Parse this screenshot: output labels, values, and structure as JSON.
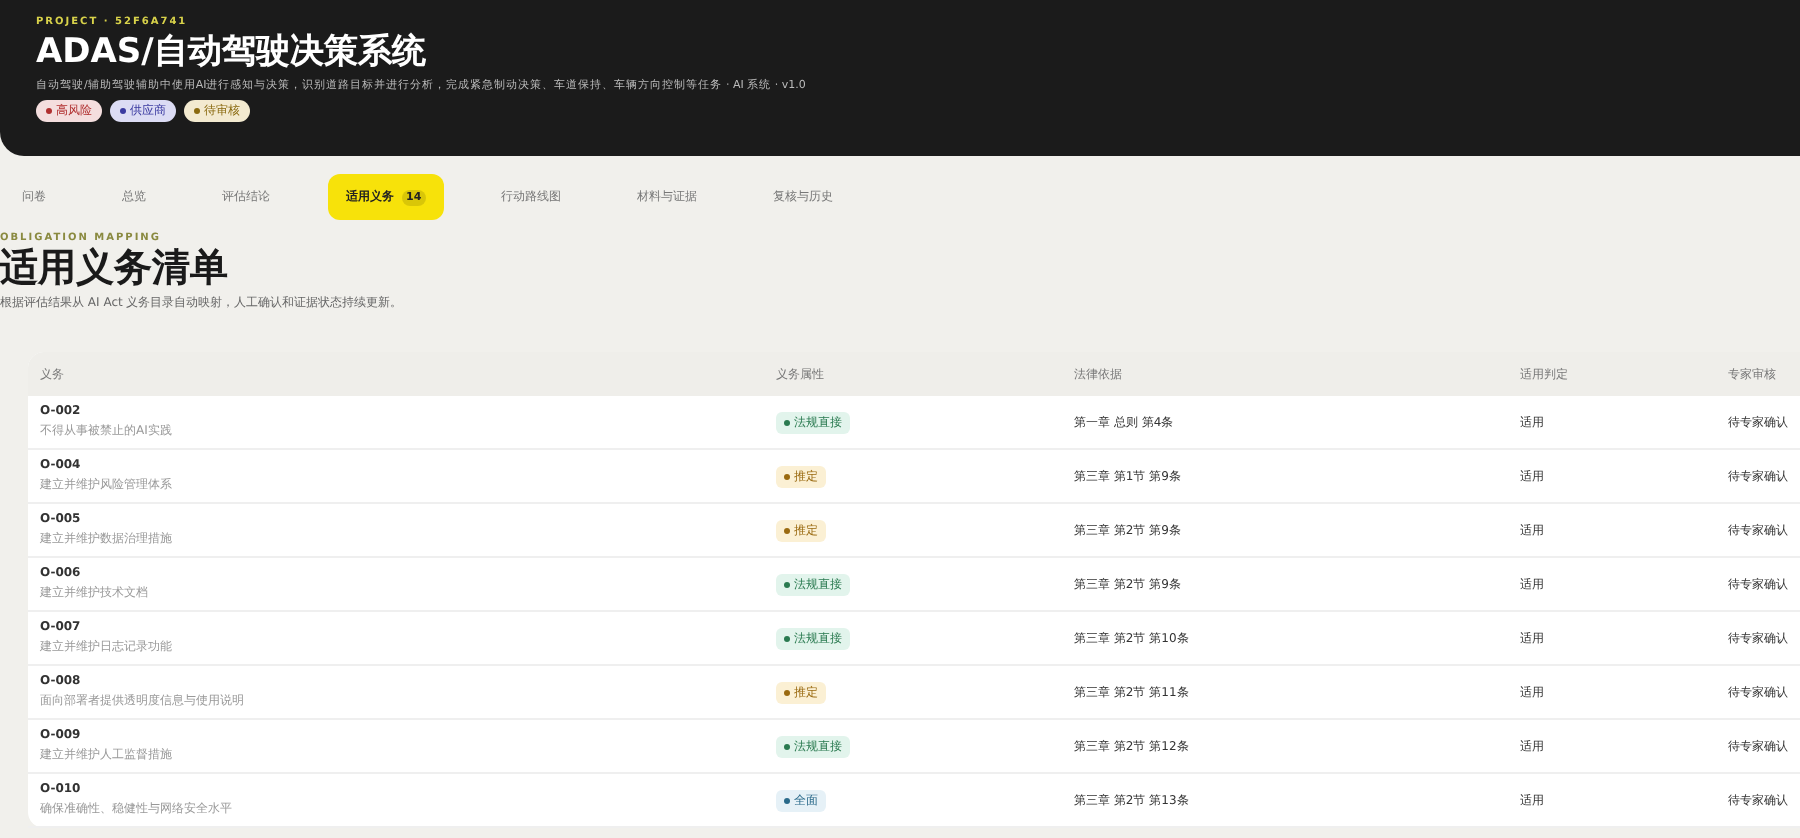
{
  "header": {
    "eyebrow": "PROJECT · 52F6A741",
    "title": "ADAS/自动驾驶决策系统",
    "description": "自动驾驶/辅助驾驶辅助中使用AI进行感知与决策，识别道路目标并进行分析，完成紧急制动决策、车道保持、车辆方向控制等任务 · AI 系统 · v1.0",
    "tags": [
      {
        "label": "高风险",
        "kind": "risk"
      },
      {
        "label": "供应商",
        "kind": "role"
      },
      {
        "label": "待审核",
        "kind": "status"
      }
    ]
  },
  "tabs": [
    {
      "label": "问卷",
      "selected": false
    },
    {
      "label": "总览",
      "selected": false
    },
    {
      "label": "评估结论",
      "selected": false
    },
    {
      "label": "适用义务",
      "badge": "14",
      "selected": true
    },
    {
      "label": "行动路线图",
      "selected": false
    },
    {
      "label": "材料与证据",
      "selected": false
    },
    {
      "label": "复核与历史",
      "selected": false
    }
  ],
  "section": {
    "eyebrow": "OBLIGATION MAPPING",
    "title": "适用义务清单",
    "description": "根据评估结果从 AI Act 义务目录自动映射，人工确认和证据状态持续更新。"
  },
  "table": {
    "columns": [
      "义务",
      "义务属性",
      "法律依据",
      "适用判定",
      "专家审核"
    ],
    "rows": [
      {
        "id": "O-002",
        "desc": "不得从事被禁止的AI实践",
        "attribute": {
          "label": "法规直接",
          "kind": "direct"
        },
        "basis": "第一章 总则 第4条",
        "verdict": "适用",
        "review": "待专家确认"
      },
      {
        "id": "O-004",
        "desc": "建立并维护风险管理体系",
        "attribute": {
          "label": "推定",
          "kind": "presumed"
        },
        "basis": "第三章 第1节 第9条",
        "verdict": "适用",
        "review": "待专家确认"
      },
      {
        "id": "O-005",
        "desc": "建立并维护数据治理措施",
        "attribute": {
          "label": "推定",
          "kind": "presumed"
        },
        "basis": "第三章 第2节 第9条",
        "verdict": "适用",
        "review": "待专家确认"
      },
      {
        "id": "O-006",
        "desc": "建立并维护技术文档",
        "attribute": {
          "label": "法规直接",
          "kind": "direct"
        },
        "basis": "第三章 第2节 第9条",
        "verdict": "适用",
        "review": "待专家确认"
      },
      {
        "id": "O-007",
        "desc": "建立并维护日志记录功能",
        "attribute": {
          "label": "法规直接",
          "kind": "direct"
        },
        "basis": "第三章 第2节 第10条",
        "verdict": "适用",
        "review": "待专家确认"
      },
      {
        "id": "O-008",
        "desc": "面向部署者提供透明度信息与使用说明",
        "attribute": {
          "label": "推定",
          "kind": "presumed"
        },
        "basis": "第三章 第2节 第11条",
        "verdict": "适用",
        "review": "待专家确认"
      },
      {
        "id": "O-009",
        "desc": "建立并维护人工监督措施",
        "attribute": {
          "label": "法规直接",
          "kind": "direct"
        },
        "basis": "第三章 第2节 第12条",
        "verdict": "适用",
        "review": "待专家确认"
      },
      {
        "id": "O-010",
        "desc": "确保准确性、稳健性与网络安全水平",
        "attribute": {
          "label": "全面",
          "kind": "full"
        },
        "basis": "第三章 第2节 第13条",
        "verdict": "适用",
        "review": "待专家确认"
      }
    ]
  }
}
